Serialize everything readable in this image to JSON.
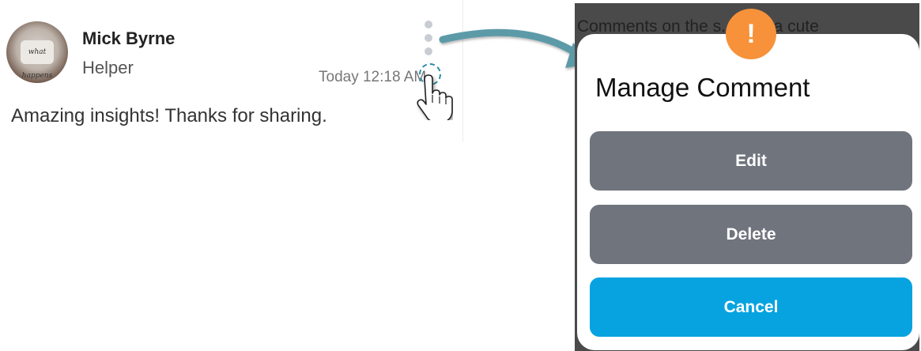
{
  "comment": {
    "author_name": "Mick Byrne",
    "author_role": "Helper",
    "timestamp": "Today 12:18 AM",
    "body": "Amazing insights! Thanks for sharing.",
    "avatar_mug_text": "what happens"
  },
  "background": {
    "post_text": "Comments on the s... with a cute"
  },
  "dialog": {
    "badge": "!",
    "title": "Manage Comment",
    "buttons": {
      "edit": "Edit",
      "delete": "Delete",
      "cancel": "Cancel"
    }
  },
  "colors": {
    "accent_orange": "#f7923a",
    "button_gray": "#6f747d",
    "button_blue": "#07a3e0",
    "arrow_teal": "#5b9aa8"
  },
  "icons": [
    "more-vertical-icon",
    "hand-pointer-icon",
    "alert-icon",
    "arrow-icon"
  ]
}
